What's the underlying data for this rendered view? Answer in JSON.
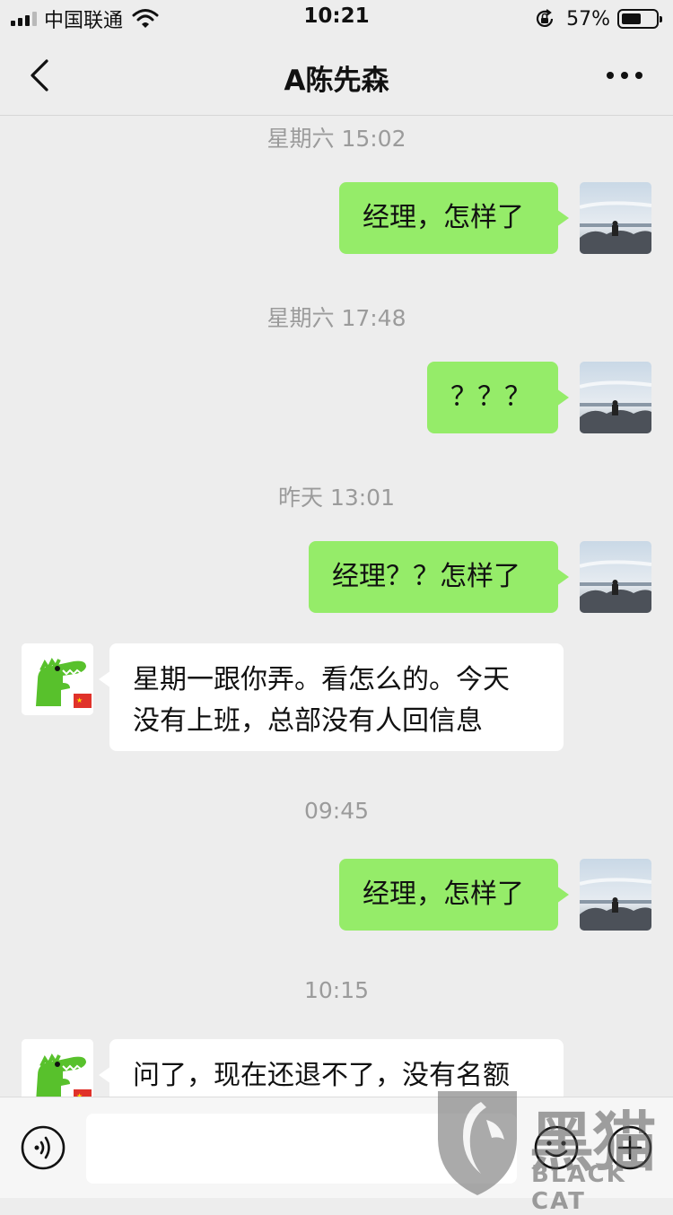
{
  "status_bar": {
    "carrier": "中国联通",
    "time": "10:21",
    "battery_percent_text": "57%",
    "battery_level": 0.57
  },
  "nav": {
    "title": "A陈先森"
  },
  "chat": {
    "messages": [
      {
        "type": "timestamp",
        "text": "星期六 15:02"
      },
      {
        "type": "outgoing",
        "text": "经理，怎样了"
      },
      {
        "type": "timestamp",
        "text": "星期六 17:48"
      },
      {
        "type": "outgoing",
        "text": "？？？"
      },
      {
        "type": "timestamp",
        "text": "昨天 13:01"
      },
      {
        "type": "outgoing",
        "text": "经理？？怎样了"
      },
      {
        "type": "incoming",
        "lines": [
          "星期一跟你弄。看怎么的。今天",
          "没有上班，总部没有人回信息"
        ]
      },
      {
        "type": "timestamp",
        "text": "09:45"
      },
      {
        "type": "outgoing",
        "text": "经理，怎样了"
      },
      {
        "type": "timestamp",
        "text": "10:15"
      },
      {
        "type": "incoming",
        "lines": [
          "问了，现在还退不了，没有名额"
        ]
      }
    ]
  },
  "input": {
    "placeholder": ""
  },
  "watermark": {
    "chinese": "黑猫",
    "english": "BLACK CAT"
  },
  "colors": {
    "background": "#ededed",
    "outgoing_bubble": "#95ec69",
    "incoming_bubble": "#ffffff",
    "timestamp_text": "#9b9b9b"
  },
  "icons": {
    "back": "chevron-left-icon",
    "more": "more-dots-icon",
    "voice": "voice-icon",
    "emoji": "emoji-icon",
    "plus": "plus-icon"
  }
}
